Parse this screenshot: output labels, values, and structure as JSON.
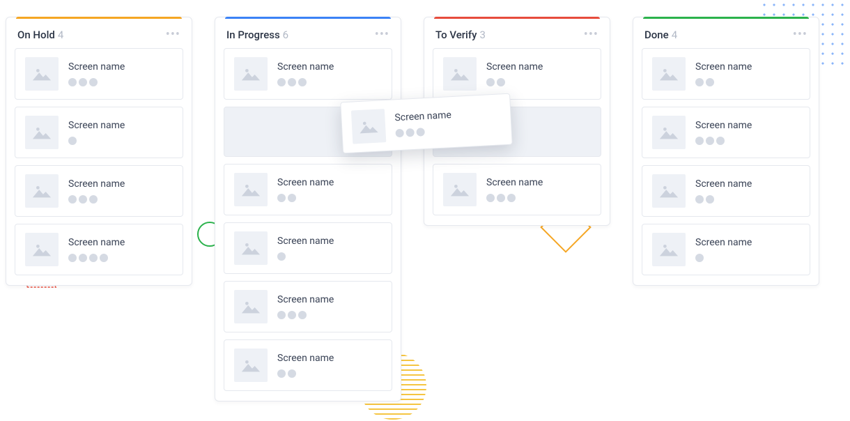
{
  "card_label": "Screen name",
  "columns": [
    {
      "title": "On Hold",
      "count": 4,
      "accent": "#f5a623",
      "cards": [
        {
          "dots": 3
        },
        {
          "dots": 1
        },
        {
          "dots": 3
        },
        {
          "dots": 4
        }
      ]
    },
    {
      "title": "In Progress",
      "count": 6,
      "accent": "#3b82f6",
      "cards": [
        {
          "dots": 3
        },
        {
          "placeholder": true
        },
        {
          "dots": 2
        },
        {
          "dots": 1
        },
        {
          "dots": 3
        },
        {
          "dots": 2
        }
      ]
    },
    {
      "title": "To Verify",
      "count": 3,
      "accent": "#e74c3c",
      "cards": [
        {
          "dots": 2
        },
        {
          "placeholder": true
        },
        {
          "dots": 3
        }
      ]
    },
    {
      "title": "Done",
      "count": 4,
      "accent": "#2bb24c",
      "cards": [
        {
          "dots": 2
        },
        {
          "dots": 3
        },
        {
          "dots": 2
        },
        {
          "dots": 1
        }
      ]
    }
  ],
  "floating_card": {
    "dots": 3
  }
}
